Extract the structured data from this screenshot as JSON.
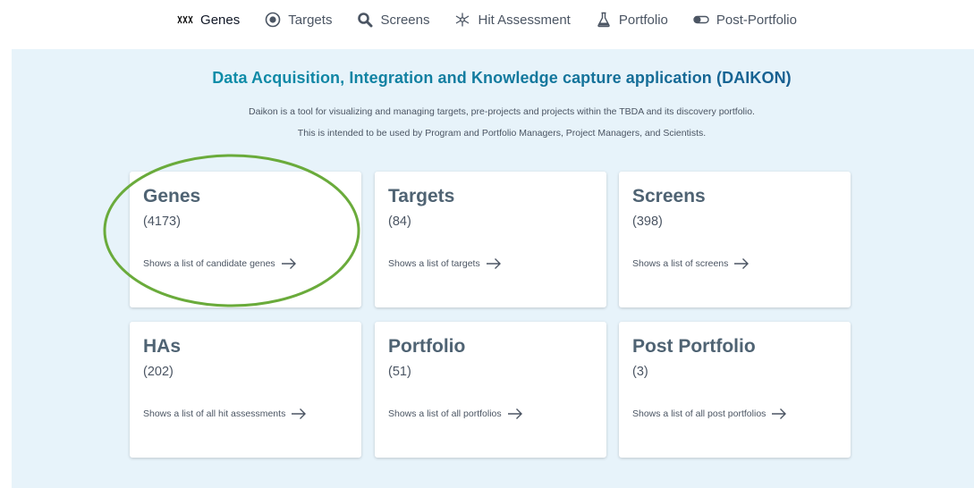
{
  "nav": [
    {
      "label": "Genes",
      "icon": "dna-icon",
      "active": true
    },
    {
      "label": "Targets",
      "icon": "target-icon",
      "active": false
    },
    {
      "label": "Screens",
      "icon": "search-icon",
      "active": false
    },
    {
      "label": "Hit Assessment",
      "icon": "molecule-icon",
      "active": false
    },
    {
      "label": "Portfolio",
      "icon": "flask-icon",
      "active": false
    },
    {
      "label": "Post-Portfolio",
      "icon": "toggle-icon",
      "active": false
    }
  ],
  "header": {
    "title": "Data Acquisition, Integration and Knowledge capture application (DAIKON)",
    "description_1": "Daikon is a tool for visualizing and managing targets, pre-projects and projects within the TBDA and its discovery portfolio.",
    "description_2": "This is intended to be used by Program and Portfolio Managers, Project Managers, and Scientists."
  },
  "cards": [
    {
      "title": "Genes",
      "count": "(4173)",
      "link": "Shows a list of candidate genes"
    },
    {
      "title": "Targets",
      "count": "(84)",
      "link": "Shows a list of targets"
    },
    {
      "title": "Screens",
      "count": "(398)",
      "link": "Shows a list of screens"
    },
    {
      "title": "HAs",
      "count": "(202)",
      "link": "Shows a list of all hit assessments"
    },
    {
      "title": "Portfolio",
      "count": "(51)",
      "link": "Shows a list of all portfolios"
    },
    {
      "title": "Post Portfolio",
      "count": "(3)",
      "link": "Shows a list of all post portfolios"
    }
  ],
  "colors": {
    "panel_bg": "#e7f3fa",
    "title_gradient_start": "#0b9bb0",
    "title_gradient_end": "#1a4a86",
    "highlight_ellipse": "#6aab3b",
    "card_title": "#4f6373"
  }
}
